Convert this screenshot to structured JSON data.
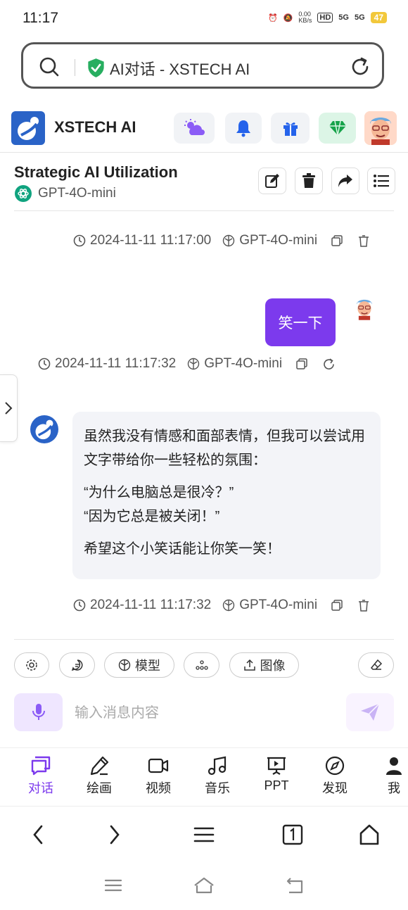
{
  "status": {
    "time": "11:17",
    "net_speed": "0.00\nKB/s",
    "hd": "HD",
    "sig1": "5G",
    "sig2": "5G",
    "battery": "47"
  },
  "browser": {
    "url_title": "AI对话 - XSTECH AI"
  },
  "app": {
    "brand": "XSTECH AI"
  },
  "chat": {
    "title": "Strategic AI Utilization",
    "model": "GPT-4O-mini",
    "messages": [
      {
        "time": "2024-11-11 11:17:00",
        "model": "GPT-4O-mini"
      },
      {
        "role": "user",
        "text": "笑一下",
        "time": "2024-11-11 11:17:32",
        "model": "GPT-4O-mini"
      },
      {
        "role": "ai",
        "para1": "虽然我没有情感和面部表情，但我可以尝试用文字带给你一些轻松的氛围：",
        "quote1": "“为什么电脑总是很冷？”",
        "quote2": "“因为它总是被关闭！”",
        "para3": "希望这个小笑话能让你笑一笑！",
        "time": "2024-11-11 11:17:32",
        "model": "GPT-4O-mini"
      }
    ]
  },
  "toolbar": {
    "model_label": "模型",
    "image_label": "图像"
  },
  "composer": {
    "placeholder": "输入消息内容"
  },
  "tabs": [
    {
      "label": "对话",
      "icon": "chat-icon"
    },
    {
      "label": "绘画",
      "icon": "paint-icon"
    },
    {
      "label": "视频",
      "icon": "video-icon"
    },
    {
      "label": "音乐",
      "icon": "music-icon"
    },
    {
      "label": "PPT",
      "icon": "ppt-icon"
    },
    {
      "label": "发现",
      "icon": "compass-icon"
    },
    {
      "label": "我",
      "icon": "user-icon"
    }
  ],
  "colors": {
    "accent": "#7c3aed",
    "brand_blue": "#2a63c7",
    "ai_bubble": "#f3f4f8"
  }
}
